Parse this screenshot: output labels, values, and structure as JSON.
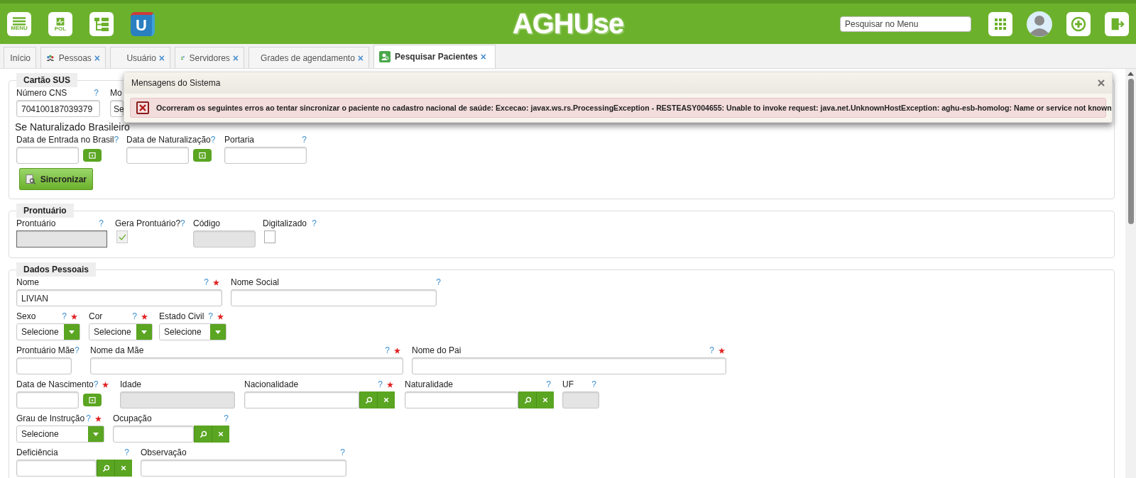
{
  "header": {
    "buttons": [
      {
        "kind": "menu",
        "label": "MENU"
      },
      {
        "kind": "pol",
        "label": "POL"
      },
      {
        "kind": "tree"
      },
      {
        "kind": "u",
        "label": "U"
      }
    ],
    "logo": "AGHUse",
    "search": {
      "placeholder": "Pesquisar no Menu"
    },
    "tools": [
      {
        "kind": "grid"
      },
      {
        "kind": "avatar"
      },
      {
        "kind": "refresh"
      },
      {
        "kind": "exit"
      }
    ]
  },
  "tabs": [
    {
      "label": "Início",
      "selected": false
    },
    {
      "label": "Pessoas",
      "close": "×",
      "selected": false
    },
    {
      "label": "Usuário",
      "close": "×",
      "selected": false
    },
    {
      "label": "Servidores",
      "close": "×",
      "selected": false
    },
    {
      "label": "Grades de agendamento",
      "close": "×",
      "selected": false
    },
    {
      "label": "Pesquisar Pacientes",
      "close": "×",
      "selected": true
    }
  ],
  "message": {
    "title": "Mensagens do Sistema",
    "text": "Ocorreram os seguintes erros ao tentar sincronizar o paciente no cadastro nacional de saúde: Excecao: javax.ws.rs.ProcessingException - RESTEASY004655: Unable to invoke request: java.net.UnknownHostException: aghu-esb-homolog: Name or service not known"
  },
  "sections": [
    {
      "title": "Cartão SUS",
      "rows": [
        {
          "kind": "fields",
          "fields": [
            {
              "kind": "text",
              "label": "Número CNS",
              "help": "?",
              "required": false,
              "value": "704100187039379",
              "readonly": false
            },
            {
              "kind": "text",
              "label": "Mo",
              "value": "Se",
              "readonly": false
            }
          ]
        },
        {
          "kind": "heading",
          "text": "Se Naturalizado Brasileiro"
        },
        {
          "kind": "fields",
          "fields": [
            {
              "kind": "date",
              "label": "Data de Entrada no Brasil",
              "help": "?",
              "required": false
            },
            {
              "kind": "date",
              "label": "Data de Naturalização",
              "help": "?",
              "required": false
            },
            {
              "kind": "text",
              "label": "Portaria",
              "help": "?",
              "required": false,
              "readonly": false
            }
          ]
        },
        {
          "kind": "button",
          "text": "Sincronizar"
        }
      ]
    },
    {
      "title": "Prontuário",
      "rows": [
        {
          "kind": "fields",
          "fields": [
            {
              "kind": "text",
              "label": "Prontuário",
              "help": "?",
              "required": false,
              "readonly": true
            },
            {
              "kind": "checkbox",
              "label": "Gera Prontuário?",
              "help": "?",
              "required": false,
              "checked": true,
              "disabled": true
            },
            {
              "kind": "text",
              "label": "Código",
              "readonly": true
            },
            {
              "kind": "checkbox",
              "label": "Digitalizado",
              "help": "?",
              "required": false,
              "checked": false,
              "disabled": false
            }
          ]
        }
      ]
    },
    {
      "title": "Dados Pessoais",
      "rows": [
        {
          "kind": "fields",
          "fields": [
            {
              "kind": "text",
              "label": "Nome",
              "help": "?",
              "required": true,
              "value": "LIVIAN",
              "readonly": false
            },
            {
              "kind": "text",
              "label": "Nome Social",
              "help": "?",
              "required": false,
              "readonly": false
            }
          ]
        },
        {
          "kind": "fields",
          "fields": [
            {
              "kind": "select",
              "label": "Sexo",
              "help": "?",
              "required": true,
              "value": "Selecione"
            },
            {
              "kind": "select",
              "label": "Cor",
              "help": "?",
              "required": true,
              "value": "Selecione"
            },
            {
              "kind": "select",
              "label": "Estado Civil",
              "help": "?",
              "required": true,
              "value": "Selecione"
            }
          ]
        },
        {
          "kind": "fields",
          "fields": [
            {
              "kind": "text",
              "label": "Prontuário Mãe",
              "help": "?",
              "required": false,
              "readonly": false
            },
            {
              "kind": "text",
              "label": "Nome da Mãe",
              "help": "?",
              "required": true,
              "readonly": false
            },
            {
              "kind": "text",
              "label": "Nome do Pai",
              "help": "?",
              "required": true,
              "readonly": false
            }
          ]
        },
        {
          "kind": "fields",
          "fields": [
            {
              "kind": "date",
              "label": "Data de Nascimento",
              "help": "?",
              "required": true
            },
            {
              "kind": "text",
              "label": "Idade",
              "readonly": true
            },
            {
              "kind": "lookup",
              "label": "Nacionalidade",
              "help": "?",
              "required": true
            },
            {
              "kind": "lookup",
              "label": "Naturalidade",
              "help": "?",
              "required": false
            },
            {
              "kind": "text",
              "label": "UF",
              "help": "?",
              "required": false,
              "readonly": true
            }
          ]
        },
        {
          "kind": "fields",
          "fields": [
            {
              "kind": "select",
              "label": "Grau de Instrução",
              "help": "?",
              "required": true,
              "value": "Selecione"
            },
            {
              "kind": "lookup",
              "label": "Ocupação",
              "help": "?",
              "required": false
            }
          ]
        },
        {
          "kind": "fields",
          "fields": [
            {
              "kind": "lookup",
              "label": "Deficiência",
              "help": "?",
              "required": false
            },
            {
              "kind": "text",
              "label": "Observação",
              "help": "?",
              "required": false,
              "readonly": false
            }
          ]
        }
      ]
    }
  ]
}
